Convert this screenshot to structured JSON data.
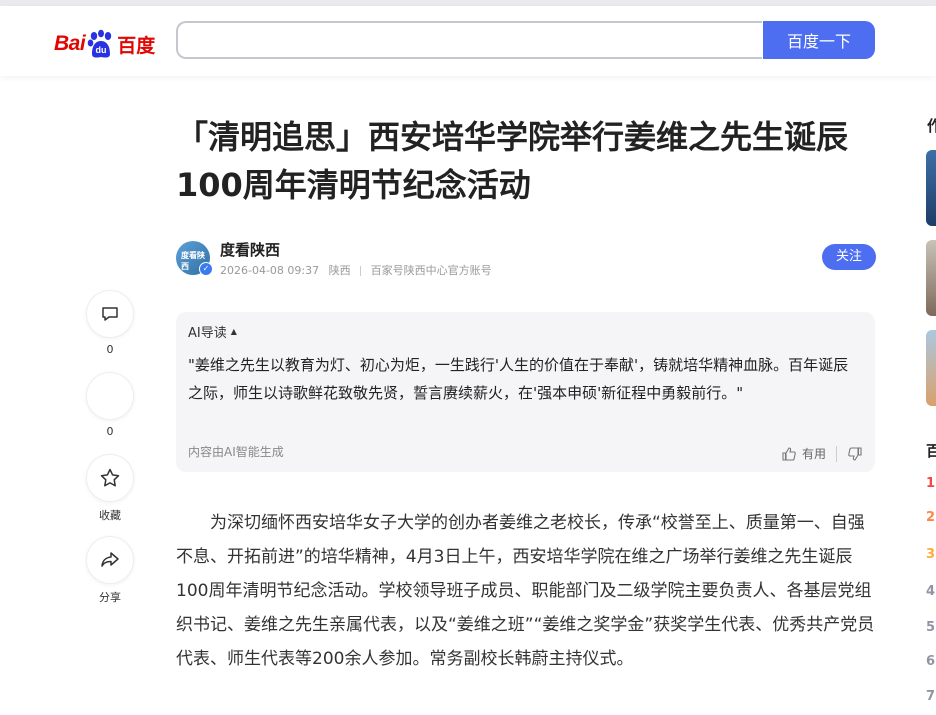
{
  "header": {
    "logo_bai": "Bai",
    "logo_paw_text": "du",
    "logo_du": "百度",
    "search_value": "",
    "search_button": "百度一下"
  },
  "article": {
    "title": "「清明追思」西安培华学院举行姜维之先生诞辰100周年清明节纪念活动",
    "author": {
      "name": "度看陕西",
      "avatar_text": "度看陕西",
      "datetime": "2026-04-08 09:37",
      "region": "陕西",
      "account_desc": "百家号陕西中心官方账号",
      "follow_label": "关注"
    },
    "ai_summary": {
      "heading": "AI导读",
      "text": "\"姜维之先生以教育为灯、初心为炬，一生践行'人生的价值在于奉献'，铸就培华精神血脉。百年诞辰之际，师生以诗歌鲜花致敬先贤，誓言赓续薪火，在'强本申硕'新征程中勇毅前行。\"",
      "footer": "内容由AI智能生成",
      "useful_label": "有用"
    },
    "paragraph": "为深切缅怀西安培华女子大学的创办者姜维之老校长，传承“校誉至上、质量第一、自强不息、开拓前进”的培华精神，4月3日上午，西安培华学院在维之广场举行姜维之先生诞辰100周年清明节纪念活动。学校领导班子成员、职能部门及二级学院主要负责人、各基层党组织书记、姜维之先生亲属代表，以及“姜维之班”“姜维之奖学金”获奖学生代表、优秀共产党员代表、师生代表等200余人参加。常务副校长韩蔚主持仪式。"
  },
  "float_bar": {
    "comment_count": "0",
    "like_count": "0",
    "collect_label": "收藏",
    "share_label": "分享"
  },
  "right_column": {
    "section_head_partial": "作",
    "hot_head_partial": "百",
    "rank_numbers": [
      "1",
      "2",
      "3",
      "4",
      "5",
      "6",
      "7"
    ],
    "rank_colors": [
      "#f54545",
      "#ff8547",
      "#ffac38",
      "#9195a3",
      "#9195a3",
      "#9195a3",
      "#9195a3"
    ]
  },
  "colors": {
    "brand_blue": "#4e6ef2",
    "logo_red": "#e10601"
  }
}
